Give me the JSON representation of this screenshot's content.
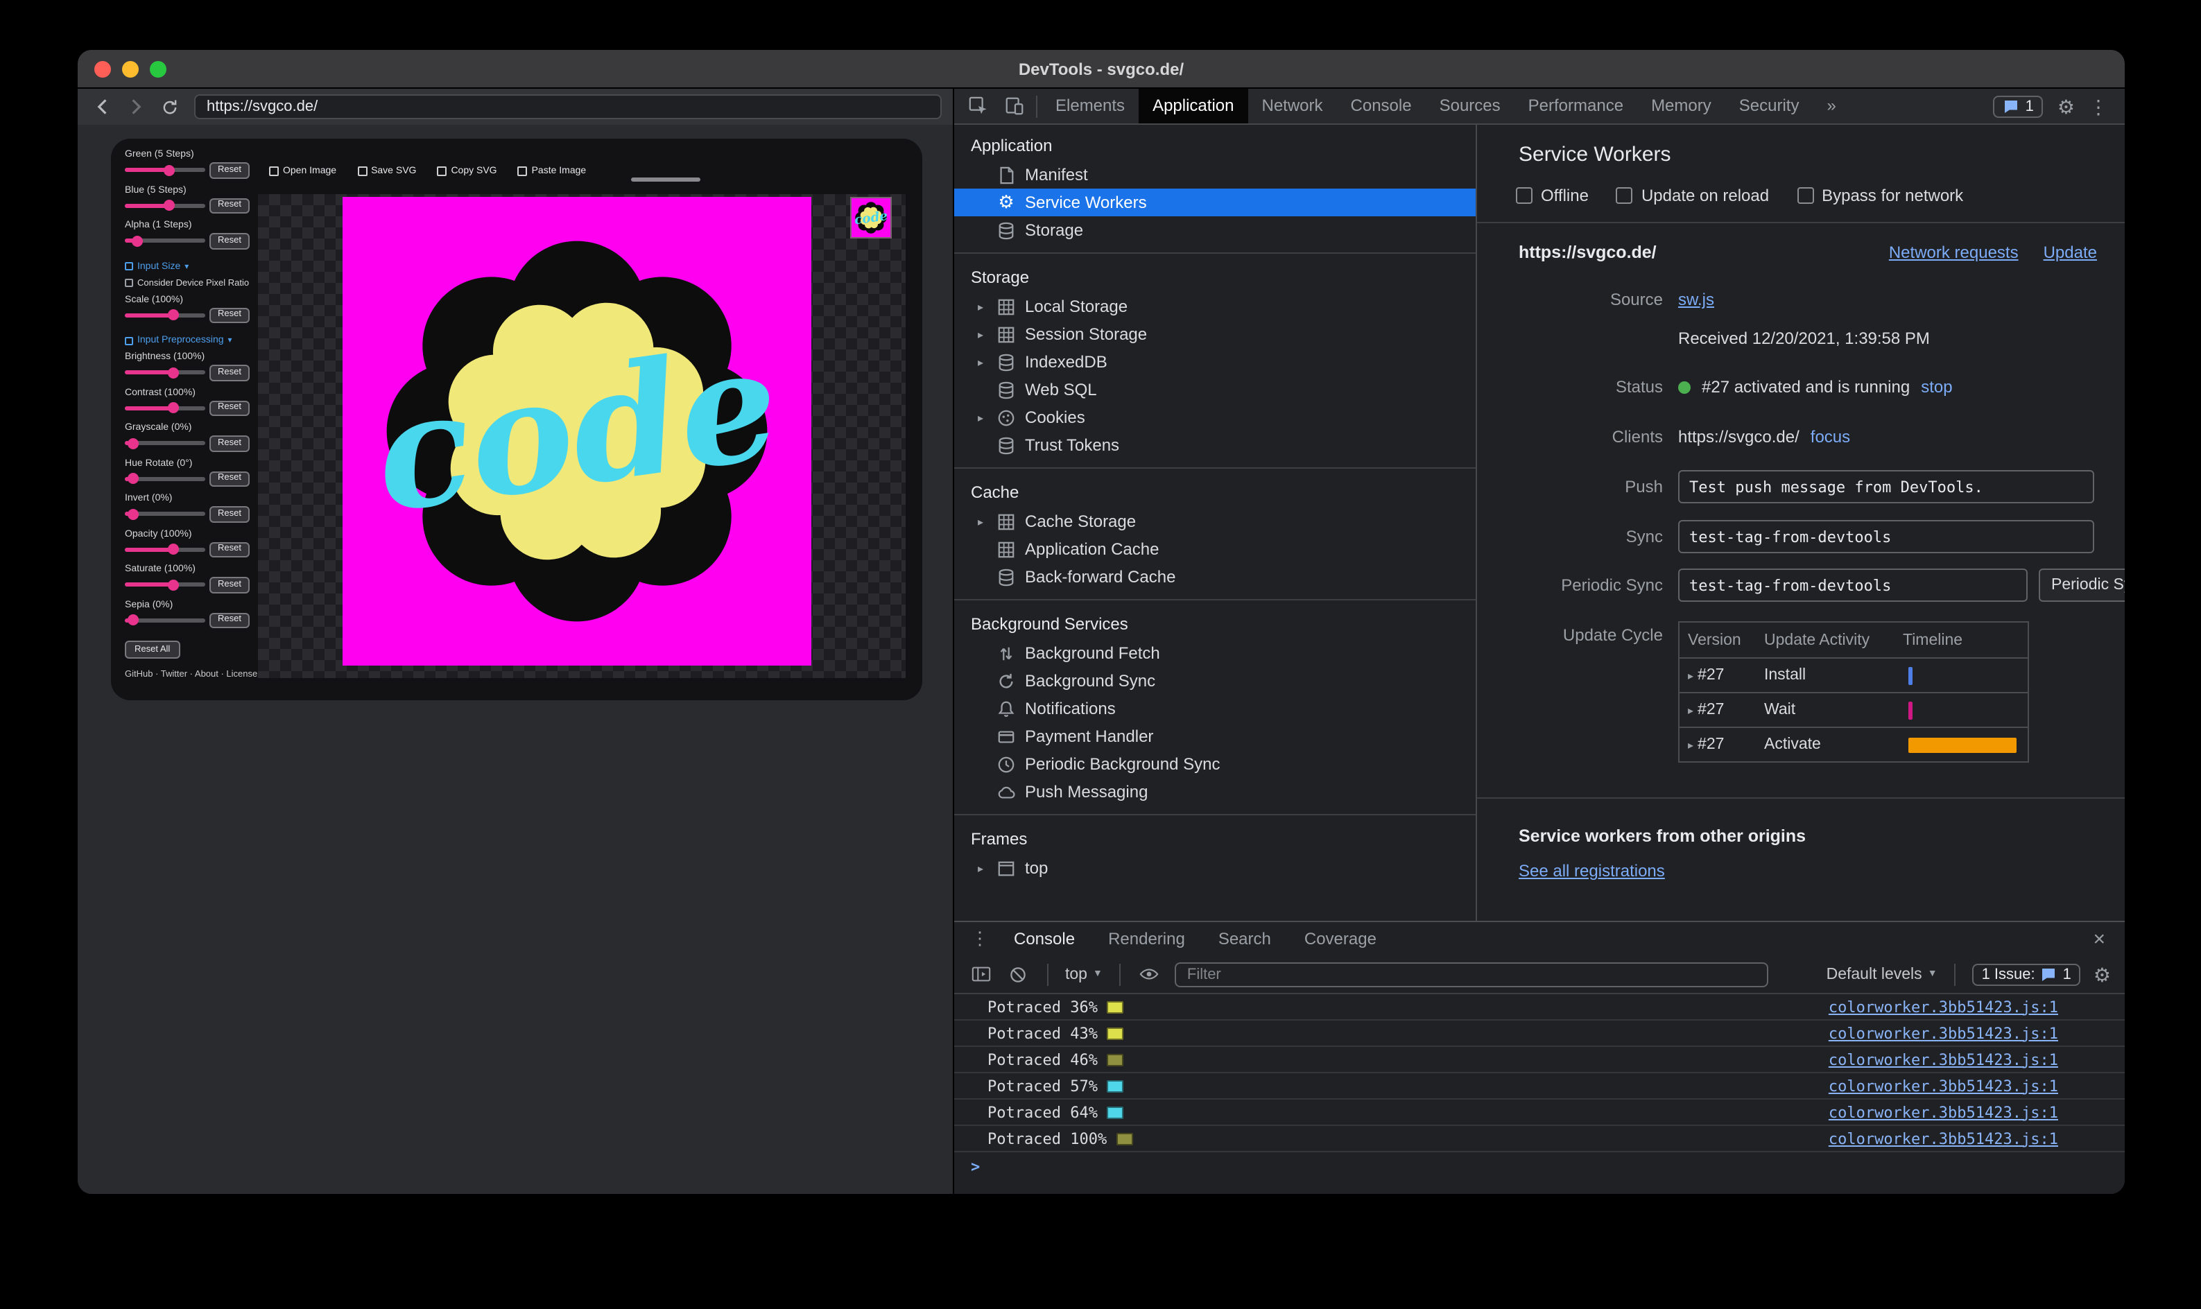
{
  "titlebar": {
    "title": "DevTools - svgco.de/"
  },
  "colors": {
    "mac_red": "#ff5f57",
    "mac_yellow": "#febc2e",
    "mac_green": "#28c840",
    "selection_blue": "#1a73e8",
    "link_blue": "#7cacf8",
    "status_green": "#4caf50",
    "slider_pink": "#e8348c",
    "logo_magenta": "#ff00f0",
    "logo_yellow": "#f0e878",
    "logo_cyan": "#49d7ee",
    "logo_black": "#0d0d0d"
  },
  "browser": {
    "url": "https://svgco.de/",
    "app": {
      "toolbar": {
        "open": "Open Image",
        "save": "Save SVG",
        "copy": "Copy SVG",
        "paste": "Paste Image"
      },
      "reset_label": "Reset",
      "sections": {
        "input_size": "Input Size",
        "input_preprocessing": "Input Preprocessing"
      },
      "device_pixel_ratio": "Consider Device Pixel Ratio",
      "sliders": [
        {
          "label": "Green (5 Steps)",
          "value": 55
        },
        {
          "label": "Blue (5 Steps)",
          "value": 55
        },
        {
          "label": "Alpha (1 Steps)",
          "value": 12
        },
        {
          "label": "Scale (100%)",
          "value": 60
        },
        {
          "label": "Brightness (100%)",
          "value": 60
        },
        {
          "label": "Contrast (100%)",
          "value": 60
        },
        {
          "label": "Grayscale (0%)",
          "value": 6
        },
        {
          "label": "Hue Rotate (0°)",
          "value": 6
        },
        {
          "label": "Invert (0%)",
          "value": 6
        },
        {
          "label": "Opacity (100%)",
          "value": 60
        },
        {
          "label": "Saturate (100%)",
          "value": 60
        },
        {
          "label": "Sepia (0%)",
          "value": 6
        }
      ],
      "reset_all": "Reset All",
      "footer": "GitHub · Twitter · About · License",
      "logo_word": "code"
    }
  },
  "devtools": {
    "tabs": [
      "Elements",
      "Application",
      "Network",
      "Console",
      "Sources",
      "Performance",
      "Memory",
      "Security"
    ],
    "overflow": "»",
    "badge_count": "1",
    "sidebar": {
      "sections": [
        {
          "title": "Application",
          "items": [
            {
              "label": "Manifest"
            },
            {
              "label": "Service Workers"
            },
            {
              "label": "Storage"
            }
          ]
        },
        {
          "title": "Storage",
          "items": [
            {
              "label": "Local Storage"
            },
            {
              "label": "Session Storage"
            },
            {
              "label": "IndexedDB"
            },
            {
              "label": "Web SQL"
            },
            {
              "label": "Cookies"
            },
            {
              "label": "Trust Tokens"
            }
          ]
        },
        {
          "title": "Cache",
          "items": [
            {
              "label": "Cache Storage"
            },
            {
              "label": "Application Cache"
            },
            {
              "label": "Back-forward Cache"
            }
          ]
        },
        {
          "title": "Background Services",
          "items": [
            {
              "label": "Background Fetch"
            },
            {
              "label": "Background Sync"
            },
            {
              "label": "Notifications"
            },
            {
              "label": "Payment Handler"
            },
            {
              "label": "Periodic Background Sync"
            },
            {
              "label": "Push Messaging"
            }
          ]
        },
        {
          "title": "Frames",
          "items": [
            {
              "label": "top"
            }
          ]
        }
      ]
    },
    "sw": {
      "title": "Service Workers",
      "offline": "Offline",
      "update_on_reload": "Update on reload",
      "bypass": "Bypass for network",
      "origin": "https://svgco.de/",
      "network_requests": "Network requests",
      "update": "Update",
      "source_label": "Source",
      "source_file": "sw.js",
      "received": "Received 12/20/2021, 1:39:58 PM",
      "status_label": "Status",
      "status": "#27 activated and is running",
      "stop": "stop",
      "clients_label": "Clients",
      "client": "https://svgco.de/",
      "focus": "focus",
      "push_label": "Push",
      "push_value": "Test push message from DevTools.",
      "sync_label": "Sync",
      "sync_value": "test-tag-from-devtools",
      "periodic_label": "Periodic Sync",
      "periodic_value": "test-tag-from-devtools",
      "periodic_button": "Periodic Sync",
      "update_cycle_label": "Update Cycle",
      "table": {
        "columns": [
          "Version",
          "Update Activity",
          "Timeline"
        ],
        "rows": [
          {
            "version": "#27",
            "activity": "Install",
            "color": "#4e7fe8"
          },
          {
            "version": "#27",
            "activity": "Wait",
            "color": "#d01884"
          },
          {
            "version": "#27",
            "activity": "Activate",
            "color": "#f29900"
          }
        ]
      },
      "other_origins": "Service workers from other origins",
      "see_all": "See all registrations"
    },
    "drawer": {
      "tabs": [
        "Console",
        "Rendering",
        "Search",
        "Coverage"
      ],
      "context": "top",
      "filter_placeholder": "Filter",
      "levels": "Default levels",
      "issue_label": "1 Issue:",
      "issue_count": "1",
      "messages": [
        {
          "text": "Potraced 36%",
          "color": "#dde04a",
          "source": "colorworker.3bb51423.js:1"
        },
        {
          "text": "Potraced 43%",
          "color": "#dde04a",
          "source": "colorworker.3bb51423.js:1"
        },
        {
          "text": "Potraced 46%",
          "color": "#8f9140",
          "source": "colorworker.3bb51423.js:1"
        },
        {
          "text": "Potraced 57%",
          "color": "#4fd6e8",
          "source": "colorworker.3bb51423.js:1"
        },
        {
          "text": "Potraced 64%",
          "color": "#4fd6e8",
          "source": "colorworker.3bb51423.js:1"
        },
        {
          "text": "Potraced 100%",
          "color": "#8f9140",
          "source": "colorworker.3bb51423.js:1"
        }
      ],
      "prompt": ">"
    }
  }
}
